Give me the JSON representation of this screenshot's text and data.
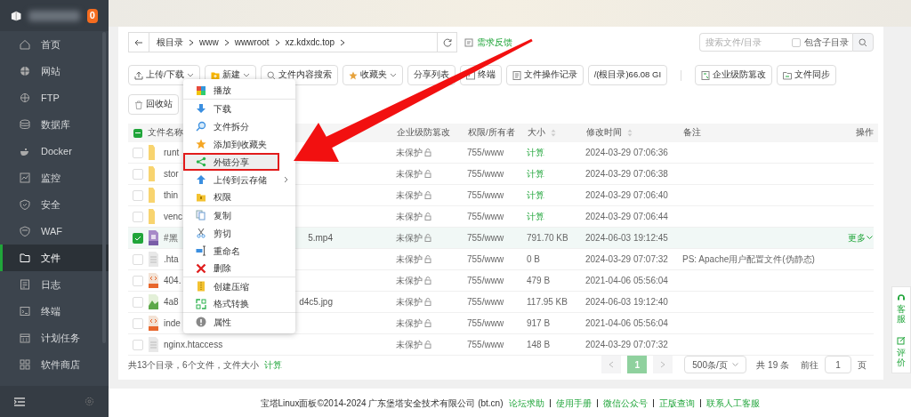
{
  "sidebar": {
    "badge": "0",
    "items": [
      {
        "label": "首页",
        "selected": false
      },
      {
        "label": "网站",
        "selected": false
      },
      {
        "label": "FTP",
        "selected": false
      },
      {
        "label": "数据库",
        "selected": false
      },
      {
        "label": "Docker",
        "selected": false
      },
      {
        "label": "监控",
        "selected": false
      },
      {
        "label": "安全",
        "selected": false
      },
      {
        "label": "WAF",
        "selected": false
      },
      {
        "label": "文件",
        "selected": true
      },
      {
        "label": "日志",
        "selected": false
      },
      {
        "label": "终端",
        "selected": false
      },
      {
        "label": "计划任务",
        "selected": false
      },
      {
        "label": "软件商店",
        "selected": false
      }
    ]
  },
  "breadcrumb": [
    "根目录",
    "www",
    "wwwroot",
    "xz.kdxdc.top"
  ],
  "feedback_link": "需求反馈",
  "search": {
    "placeholder": "搜索文件/目录",
    "include_subdirs": {
      "label": "包含子目录",
      "checked": false
    }
  },
  "toolbar": [
    {
      "label": "上传/下载",
      "dropdown": true
    },
    {
      "label": "新建",
      "dropdown": true
    },
    {
      "label": "文件内容搜索",
      "dropdown": false
    },
    {
      "label": "收藏夹",
      "dropdown": true
    },
    {
      "label": "分享列表",
      "dropdown": false
    },
    {
      "label": "终端",
      "dropdown": false
    },
    {
      "label": "文件操作记录",
      "dropdown": false
    },
    {
      "label": "/(根目录)66.08 GI",
      "dropdown": false
    },
    {
      "label": "企业级防篡改",
      "dropdown": false
    },
    {
      "label": "文件同步",
      "dropdown": false
    },
    {
      "label": "回收站",
      "dropdown": false
    }
  ],
  "table": {
    "select_all": {
      "indeterminate": true
    },
    "columns": [
      "文件名称",
      "企业级防篡改",
      "权限/所有者",
      "大小",
      "修改时间",
      "备注",
      "操作"
    ],
    "rows": [
      {
        "kind": "folder",
        "checked": false,
        "name_start": "runt",
        "name_end": "",
        "protection": "未保护",
        "permission": "755/www",
        "size": "计算",
        "modified": "2024-03-29 07:06:36",
        "note": "",
        "action": ""
      },
      {
        "kind": "folder",
        "checked": false,
        "name_start": "stor",
        "name_end": "",
        "protection": "未保护",
        "permission": "755/www",
        "size": "计算",
        "modified": "2024-03-29 07:06:38",
        "note": "",
        "action": ""
      },
      {
        "kind": "folder",
        "checked": false,
        "name_start": "thin",
        "name_end": "",
        "protection": "未保护",
        "permission": "755/www",
        "size": "计算",
        "modified": "2024-03-29 07:06:40",
        "note": "",
        "action": ""
      },
      {
        "kind": "folder",
        "checked": false,
        "name_start": "venc",
        "name_end": "",
        "protection": "未保护",
        "permission": "755/www",
        "size": "计算",
        "modified": "2024-03-29 07:06:44",
        "note": "",
        "action": ""
      },
      {
        "kind": "video",
        "checked": true,
        "name_start": "#黑",
        "name_end": "5.mp4",
        "protection": "未保护",
        "permission": "755/www",
        "size": "791.70 KB",
        "modified": "2024-06-03 19:12:45",
        "note": "",
        "action": "更多"
      },
      {
        "kind": "text",
        "checked": false,
        "name_start": ".hta",
        "name_end": "",
        "protection": "未保护",
        "permission": "755/www",
        "size": "0 B",
        "modified": "2024-03-29 07:07:32",
        "note": "PS: Apache用户配置文件(伪静态)",
        "action": ""
      },
      {
        "kind": "code",
        "checked": false,
        "name_start": "404.",
        "name_end": "",
        "protection": "未保护",
        "permission": "755/www",
        "size": "479 B",
        "modified": "2021-04-06 05:56:04",
        "note": "",
        "action": ""
      },
      {
        "kind": "image",
        "checked": false,
        "name_start": "4a8",
        "name_end": "d4c5.jpg",
        "protection": "未保护",
        "permission": "755/www",
        "size": "117.95 KB",
        "modified": "2024-06-03 19:12:40",
        "note": "",
        "action": ""
      },
      {
        "kind": "code",
        "checked": false,
        "name_start": "inde",
        "name_end": "",
        "protection": "未保护",
        "permission": "755/www",
        "size": "917 B",
        "modified": "2021-04-06 05:56:04",
        "note": "",
        "action": ""
      },
      {
        "kind": "text",
        "checked": false,
        "name_start": "nginx.htaccess",
        "name_end": "",
        "protection": "未保护",
        "permission": "755/www",
        "size": "148 B",
        "modified": "2024-03-29 07:07:32",
        "note": "",
        "action": ""
      }
    ]
  },
  "context_menu": [
    {
      "label": "播放",
      "highlighted": false,
      "submenu": false,
      "divider_after": true
    },
    {
      "label": "下载",
      "highlighted": false,
      "submenu": false,
      "divider_after": false
    },
    {
      "label": "文件拆分",
      "highlighted": false,
      "submenu": false,
      "divider_after": false
    },
    {
      "label": "添加到收藏夹",
      "highlighted": false,
      "submenu": false,
      "divider_after": false
    },
    {
      "label": "外链分享",
      "highlighted": true,
      "submenu": false,
      "divider_after": false
    },
    {
      "label": "上传到云存储",
      "highlighted": false,
      "submenu": true,
      "divider_after": false
    },
    {
      "label": "权限",
      "highlighted": false,
      "submenu": false,
      "divider_after": true
    },
    {
      "label": "复制",
      "highlighted": false,
      "submenu": false,
      "divider_after": false
    },
    {
      "label": "剪切",
      "highlighted": false,
      "submenu": false,
      "divider_after": false
    },
    {
      "label": "重命名",
      "highlighted": false,
      "submenu": false,
      "divider_after": false
    },
    {
      "label": "删除",
      "highlighted": false,
      "submenu": false,
      "divider_after": true
    },
    {
      "label": "创建压缩",
      "highlighted": false,
      "submenu": false,
      "divider_after": false
    },
    {
      "label": "格式转换",
      "highlighted": false,
      "submenu": false,
      "divider_after": true
    },
    {
      "label": "属性",
      "highlighted": false,
      "submenu": false,
      "divider_after": false
    }
  ],
  "summary": {
    "text": "共13个目录，6个文件，文件大小",
    "link": "计算"
  },
  "pagination": {
    "pages": [
      {
        "label": "1",
        "selected": true
      }
    ],
    "page_size": "500条/页",
    "total": "共 19 条",
    "goto_label": "前往",
    "goto_value": "1",
    "goto_suffix": "页"
  },
  "float_panel": [
    "客服",
    "评价"
  ],
  "footer": {
    "copyright": "宝塔Linux面板©2014-2024 广东堡塔安全技术有限公司 (bt.cn)",
    "links": [
      "论坛求助",
      "使用手册",
      "微信公众号",
      "正版查询",
      "联系人工客服"
    ]
  }
}
